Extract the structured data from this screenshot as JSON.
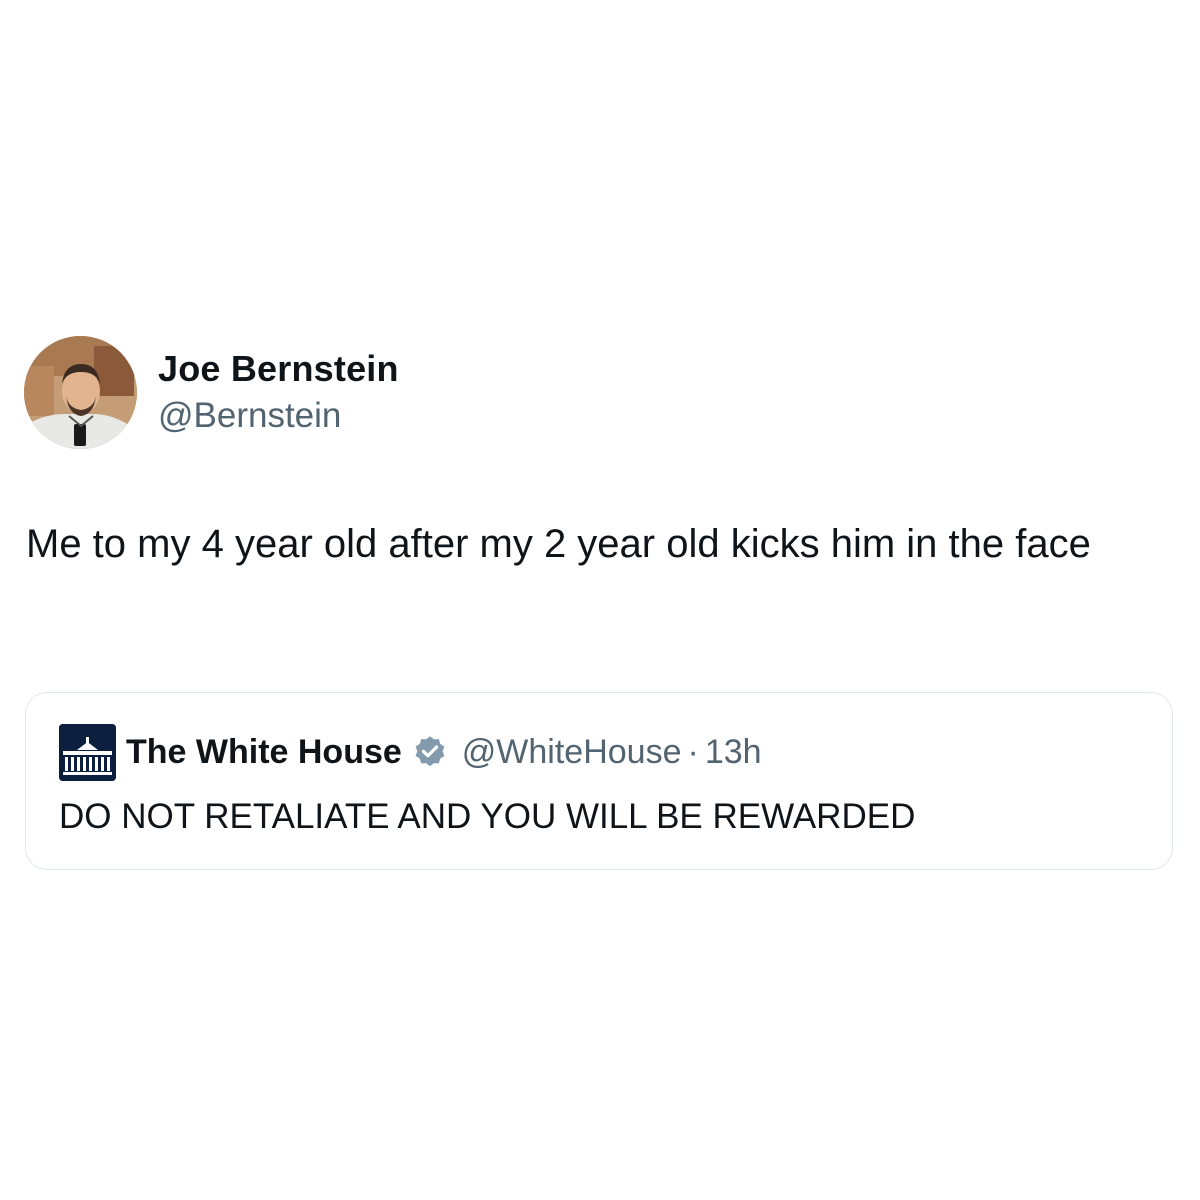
{
  "tweet": {
    "author_name": "Joe Bernstein",
    "author_handle": "@Bernstein",
    "text": "Me to my 4 year old after my 2 year old kicks him in the face"
  },
  "quoted_tweet": {
    "author_name": "The White House",
    "verified_icon": "verified-badge-icon",
    "author_handle": "@WhiteHouse",
    "separator": "·",
    "time": "13h",
    "text": "DO NOT RETALIATE AND YOU WILL BE REWARDED"
  },
  "colors": {
    "text_primary": "#0f1419",
    "text_secondary": "#536471",
    "verified_badge": "#829aab",
    "card_border": "#e1e6ea"
  }
}
